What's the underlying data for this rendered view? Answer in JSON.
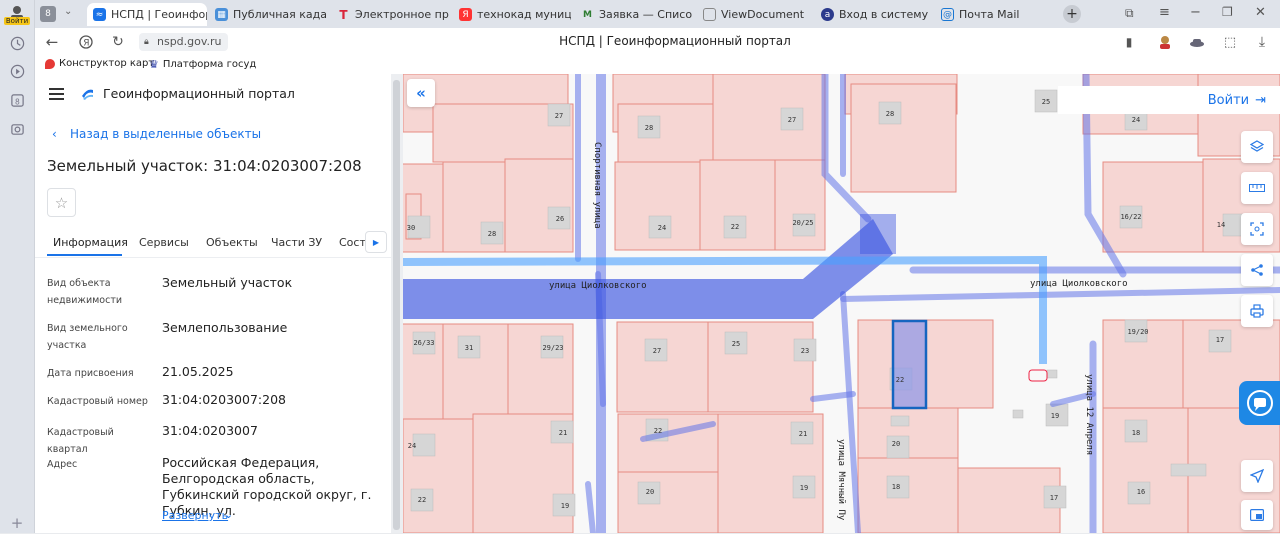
{
  "browser": {
    "profile_label": "Войти",
    "tabs": [
      {
        "title": "НСПД | Геоинфор",
        "icon": "nspd-icon",
        "color": "#1a73e8"
      },
      {
        "title": "Публичная кадастр",
        "icon": "map-icon",
        "color": "#4a90d9"
      },
      {
        "title": "Электронное прави",
        "icon": "consultant-icon",
        "color": "#d9263b"
      },
      {
        "title": "технокад муниципа",
        "icon": "yandex-icon",
        "color": "#f33"
      },
      {
        "title": "Заявка — Список за",
        "icon": "mail-icon",
        "color": "#2e7d32"
      },
      {
        "title": "ViewDocument",
        "icon": "document-icon",
        "color": "#888"
      },
      {
        "title": "Вход в систему",
        "icon": "login-icon",
        "color": "#2b3a8c"
      },
      {
        "title": "Почта Mail",
        "icon": "envelope-icon",
        "color": "#1976d2"
      }
    ],
    "url": "nspd.gov.ru",
    "page_title": "НСПД | Геоинформационный портал",
    "bookmarks": [
      {
        "label": "Конструктор карт",
        "icon": "pin-icon"
      },
      {
        "label": "Платформа госуд",
        "icon": "emblem-icon"
      }
    ]
  },
  "panel": {
    "portal_title": "Геоинформационный портал",
    "back_link": "Назад в выделенные объекты",
    "object_title": "Земельный участок: 31:04:0203007:208",
    "tabs": [
      "Информация",
      "Сервисы",
      "Объекты",
      "Части ЗУ",
      "Соста"
    ],
    "active_tab": "Информация",
    "fields": [
      {
        "label": "Вид объекта недвижимости",
        "value": "Земельный участок"
      },
      {
        "label": "Вид земельного участка",
        "value": "Землепользование"
      },
      {
        "label": "Дата присвоения",
        "value": "21.05.2025"
      },
      {
        "label": "Кадастровый номер",
        "value": "31:04:0203007:208"
      },
      {
        "label": "Кадастровый квартал",
        "value": "31:04:0203007"
      },
      {
        "label": "Адрес",
        "value": "Российская Федерация, Белгородская область, Губкинский городской округ, г. Губкин, ул."
      }
    ],
    "expand_label": "Развернуть"
  },
  "map": {
    "login_label": "Войти",
    "streets": [
      "улица Циолковского",
      "улица Циолковского",
      "Спортивная улица",
      "улица 12 Апреля",
      "улица Мячный Пу"
    ],
    "house_numbers": [
      "27",
      "28",
      "27",
      "28",
      "25",
      "24",
      "30",
      "28",
      "26",
      "24",
      "22",
      "20/25",
      "16/22",
      "14",
      "26/33",
      "31",
      "29/23",
      "27",
      "25",
      "23",
      "22",
      "19/20",
      "17",
      "19",
      "24",
      "21",
      "22",
      "21",
      "20",
      "18",
      "22",
      "19",
      "20",
      "19",
      "18",
      "17",
      "16"
    ]
  },
  "colors": {
    "accent": "#1a73e8",
    "parcel": "#f2c9c6",
    "parcel_border": "#e88a80",
    "road": "#3b5bdb",
    "selected": "#1565c0"
  }
}
